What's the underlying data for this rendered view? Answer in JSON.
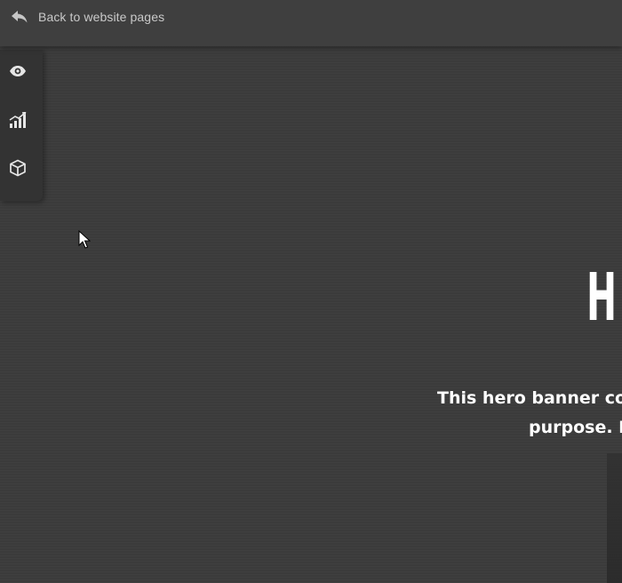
{
  "topbar": {
    "back_label": "Back to website pages",
    "back_icon": "reply-arrow-icon"
  },
  "sidebar": {
    "items": [
      {
        "name": "preview",
        "icon": "eye-icon"
      },
      {
        "name": "analytics",
        "icon": "bar-chart-icon"
      },
      {
        "name": "blocks",
        "icon": "cube-icon"
      }
    ]
  },
  "hero": {
    "title_partial": "H",
    "text_line1": "This hero banner co",
    "text_line2": "purpose. I"
  },
  "colors": {
    "background": "#3b3b3b",
    "topbar": "#3f3f3f",
    "sidebar": "#333333",
    "text_muted": "#c9c9c9",
    "text_hero": "#ffffff"
  }
}
